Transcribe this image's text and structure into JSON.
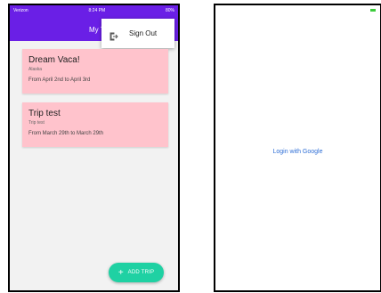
{
  "left_screen": {
    "status": {
      "carrier": "Verizon",
      "time": "8:24 PM",
      "battery": "80%"
    },
    "app_bar": {
      "title": "My Tr"
    },
    "menu": {
      "icon": "logout-icon",
      "sign_out_label": "Sign Out"
    },
    "trips": [
      {
        "title": "Dream Vaca!",
        "subtitle": "Alaska",
        "dates": "From April 2nd to April 3rd"
      },
      {
        "title": "Trip test",
        "subtitle": "Trip test",
        "dates": "From March 29th to March 29th"
      }
    ],
    "fab": {
      "icon": "plus-icon",
      "label": "ADD TRIP"
    },
    "colors": {
      "app_bar": "#6a1fe6",
      "card": "#ffc3cc",
      "fab": "#1fd1a3"
    }
  },
  "right_screen": {
    "login_link": "Login with Google",
    "colors": {
      "link": "#2f6fd6",
      "battery": "#3ccc3c"
    }
  }
}
